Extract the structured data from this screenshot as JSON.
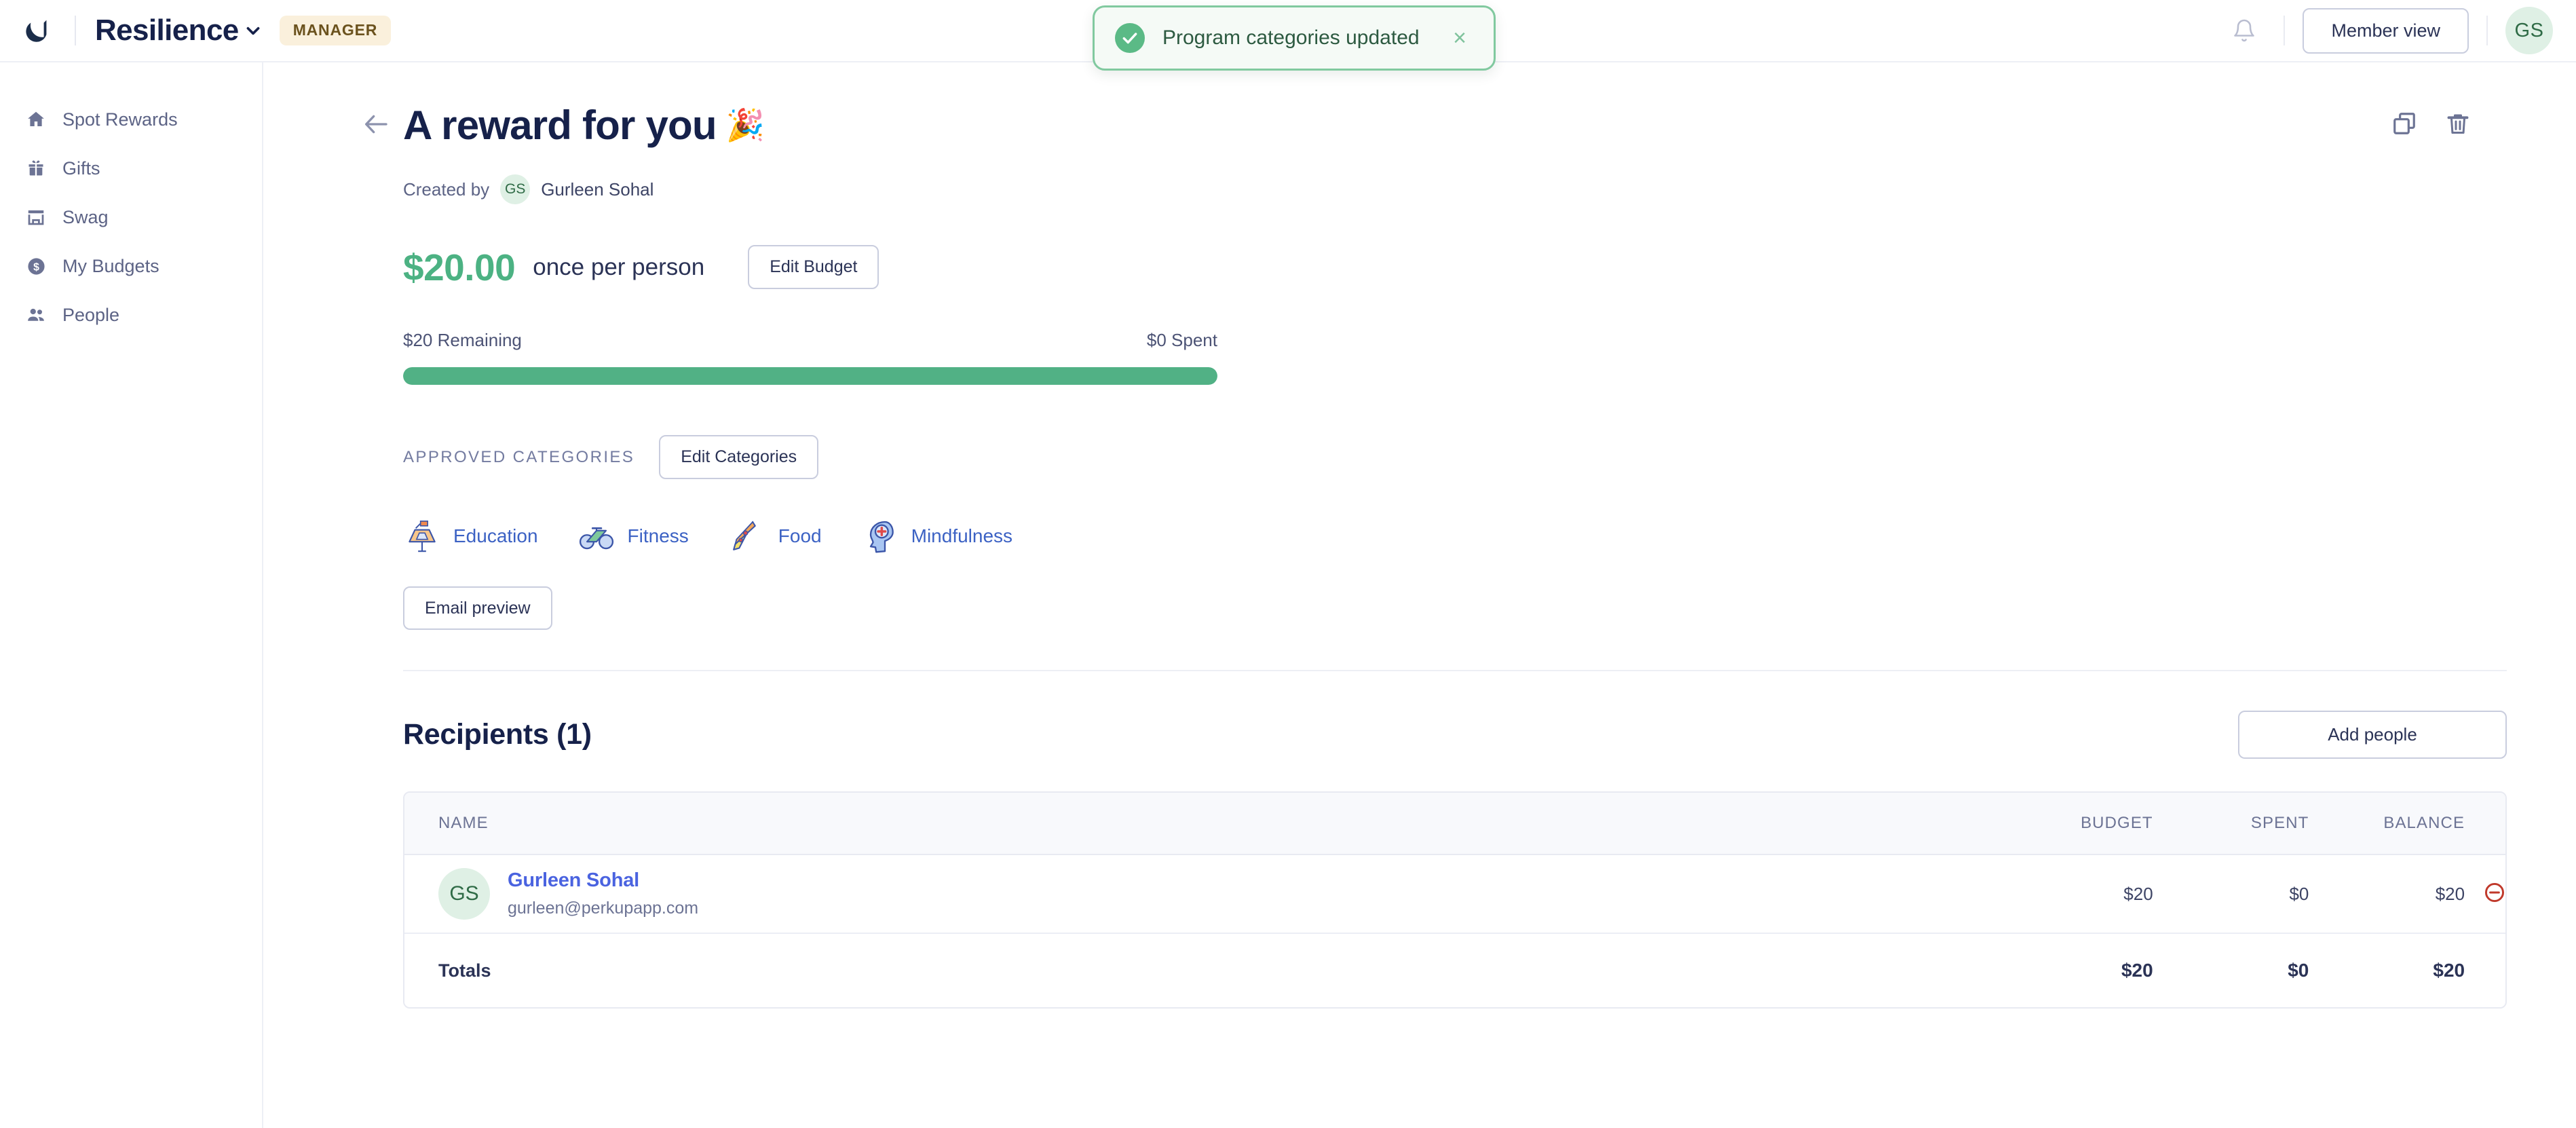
{
  "topbar": {
    "logo_icon": "resilience-logo-mark",
    "brand": "Resilience",
    "brand_caret_icon": "chevron-down-icon",
    "role_badge": "MANAGER",
    "bell_icon": "bell-icon",
    "member_view_label": "Member view",
    "avatar_initials": "GS"
  },
  "toast": {
    "check_icon": "check-circle-icon",
    "message": "Program categories updated",
    "close_icon": "close-icon",
    "accent_border": "#81c99f",
    "accent_bg": "#f5faf6",
    "check_bg": "#5bba86"
  },
  "sidebar": {
    "items": [
      {
        "label": "Spot Rewards",
        "icon": "home-icon"
      },
      {
        "label": "Gifts",
        "icon": "gift-icon"
      },
      {
        "label": "Swag",
        "icon": "store-icon"
      },
      {
        "label": "My Budgets",
        "icon": "dollar-circle-icon"
      },
      {
        "label": "People",
        "icon": "people-icon"
      }
    ]
  },
  "page": {
    "back_icon": "back-arrow-icon",
    "title": "A reward for you",
    "title_emoji": "🎉",
    "duplicate_icon": "duplicate-icon",
    "delete_icon": "trash-icon",
    "created_by_label": "Created by",
    "creator_initials": "GS",
    "creator_name": "Gurleen Sohal"
  },
  "budget": {
    "amount": "$20.00",
    "frequency": "once per person",
    "edit_label": "Edit Budget",
    "remaining_label": "$20 Remaining",
    "spent_label": "$0 Spent",
    "progress_percent": 100,
    "bar_color": "#51b185"
  },
  "categories": {
    "section_label": "APPROVED CATEGORIES",
    "edit_label": "Edit Categories",
    "items": [
      {
        "label": "Education",
        "icon": "education-icon"
      },
      {
        "label": "Fitness",
        "icon": "bicycle-icon"
      },
      {
        "label": "Food",
        "icon": "pizza-icon"
      },
      {
        "label": "Mindfulness",
        "icon": "mindfulness-head-icon"
      }
    ],
    "label_color": "#3c62c4"
  },
  "email_preview": {
    "label": "Email preview"
  },
  "recipients": {
    "title": "Recipients (1)",
    "add_people_label": "Add people",
    "columns": {
      "name": "NAME",
      "budget": "BUDGET",
      "spent": "SPENT",
      "balance": "BALANCE"
    },
    "rows": [
      {
        "initials": "GS",
        "name": "Gurleen Sohal",
        "email": "gurleen@perkupapp.com",
        "budget": "$20",
        "spent": "$0",
        "balance": "$20",
        "remove_icon": "remove-circle-icon"
      }
    ],
    "totals": {
      "label": "Totals",
      "budget": "$20",
      "spent": "$0",
      "balance": "$20"
    }
  }
}
